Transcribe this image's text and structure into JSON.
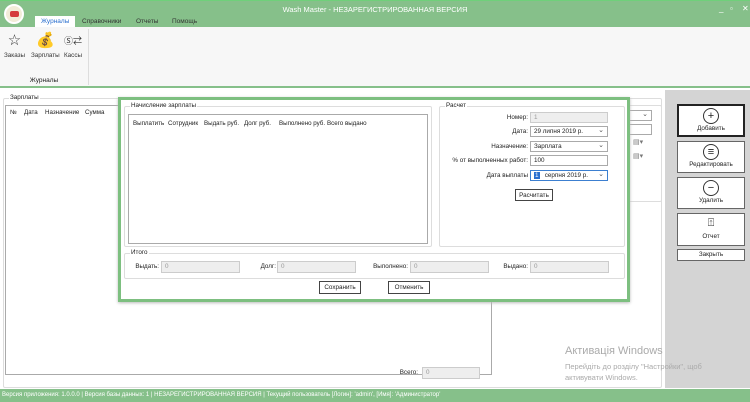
{
  "window": {
    "title": "Wash Master - НЕЗАРЕГИСТРИРОВАННАЯ ВЕРСИЯ"
  },
  "tabs": [
    "Журналы",
    "Справочники",
    "Отчеты",
    "Помощь"
  ],
  "ribbon": {
    "buttons": [
      {
        "label": "Заказы",
        "icon": "star-icon"
      },
      {
        "label": "Зарплаты",
        "icon": "money-bag-icon"
      },
      {
        "label": "Кассы",
        "icon": "cash-exchange-icon"
      }
    ],
    "group": "Журналы"
  },
  "main": {
    "group": "Зарплаты",
    "columns": [
      "№",
      "Дата",
      "Назначение",
      "Сумма"
    ],
    "total_label": "Всего:",
    "total_value": "0"
  },
  "side": {
    "buttons": [
      "Добавить",
      "Редактировать",
      "Удалить",
      "Отчет",
      "Закрыть"
    ]
  },
  "dialog": {
    "list_group": "Начисление зарплаты",
    "columns": [
      "Выплатить",
      "Сотрудник",
      "Выдать руб.",
      "Долг руб.",
      "Выполнено руб.",
      "Всего выдано"
    ],
    "calc_group": "Расчет",
    "number_label": "Номер:",
    "number_value": "1",
    "date_label": "Дата:",
    "date_value": "29    липня    2019 р.",
    "purpose_label": "Назначение:",
    "purpose_value": "Зарплата",
    "percent_label": "% от выполненных работ:",
    "percent_value": "100",
    "paydate_label": "Дата выплаты",
    "paydate_day": "1",
    "paydate_rest": "серпня    2019 р.",
    "calc_button": "Расчитать",
    "totals_group": "Итого",
    "totals": [
      {
        "label": "Выдать:",
        "value": "0"
      },
      {
        "label": "Долг:",
        "value": "0"
      },
      {
        "label": "Выполнено:",
        "value": "0"
      },
      {
        "label": "Выдано:",
        "value": "0"
      }
    ],
    "save": "Сохранить",
    "cancel": "Отменить"
  },
  "watermark": {
    "title": "Активація Windows",
    "line1": "Перейдіть до розділу \"Настройки\", щоб",
    "line2": "активувати Windows."
  },
  "status": "Версия приложения: 1.0.0.0 | Версия базы данных: 1 | НЕЗАРЕГИСТРИРОВАННАЯ ВЕРСИЯ | Текущий пользователь [Логин]: 'admin', [Имя]: 'Администратор'"
}
